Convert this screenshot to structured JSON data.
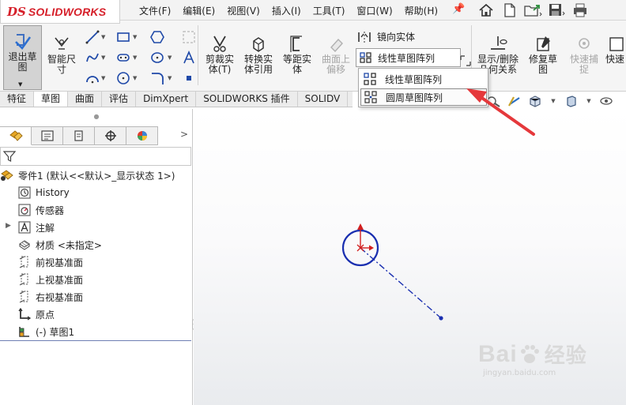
{
  "app": {
    "logo_prefix": "DS",
    "logo_name": "SOLIDWORKS"
  },
  "menus": [
    "文件(F)",
    "编辑(E)",
    "视图(V)",
    "插入(I)",
    "工具(T)",
    "窗口(W)",
    "帮助(H)"
  ],
  "quick_access": [
    "home-icon",
    "new-document-icon",
    "open-folder-icon",
    "save-icon",
    "print-icon"
  ],
  "commands": {
    "exit_sketch": "退出草\n图",
    "smart_dimension": "智能尺\n寸",
    "trim_entities": "剪裁实\n体(T)",
    "convert_entities": "转换实\n体引用",
    "offset_entities": "等距实\n体",
    "offset_on_surface": "曲面上\n偏移",
    "mirror_entities": "镜向实体",
    "linear_pattern": "线性草图阵列",
    "display_relations": "显示/删除\n几何关系",
    "repair_sketch": "修复草\n图",
    "rapid_snaps": "快速捕\n捉",
    "rapid_sketch": "快速"
  },
  "tabs": [
    "特征",
    "草图",
    "曲面",
    "评估",
    "DimXpert",
    "SOLIDWORKS 插件",
    "SOLIDV"
  ],
  "active_tab": "草图",
  "dropdown": {
    "items": [
      "线性草图阵列",
      "圆周草图阵列"
    ],
    "hovered": "圆周草图阵列"
  },
  "feature_tree": {
    "part": "零件1  (默认<<默认>_显示状态 1>)",
    "items": [
      "History",
      "传感器",
      "注解",
      "材质 <未指定>",
      "前视基准面",
      "上视基准面",
      "右视基准面",
      "原点",
      "(-) 草图1"
    ]
  },
  "watermark": {
    "brand": "Bai",
    "brand2": "经验",
    "url": "jingyan.baidu.com"
  },
  "colors": {
    "sketch": "#1a2fb0",
    "annotation_arrow": "#e5383b",
    "origin": "#d21f1f"
  }
}
